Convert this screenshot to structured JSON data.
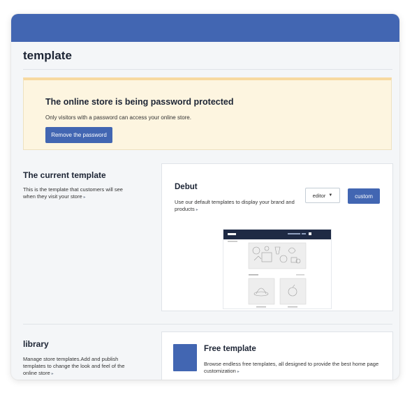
{
  "header": {
    "title": "template"
  },
  "banner": {
    "title": "The online store is being password protected",
    "text": "Only visitors with a password can access your online store.",
    "button": "Remove the password"
  },
  "current_template": {
    "heading": "The current template",
    "description": "This is the template that customers will see when they visit your store",
    "theme_name": "Debut",
    "theme_description": "Use our default templates to display your brand and products",
    "editor_label": "editor",
    "custom_label": "custom"
  },
  "library": {
    "heading": "library",
    "description": "Manage store templates.Add and publish templates to change the look and feel of the online store",
    "free_title": "Free template",
    "free_description": "Browse endless free templates, all designed to provide the best home page customization"
  },
  "colors": {
    "accent": "#4266b2",
    "banner_bg": "#fdf5e0",
    "banner_border": "#f7d9a0",
    "page_bg": "#f4f6f8"
  }
}
